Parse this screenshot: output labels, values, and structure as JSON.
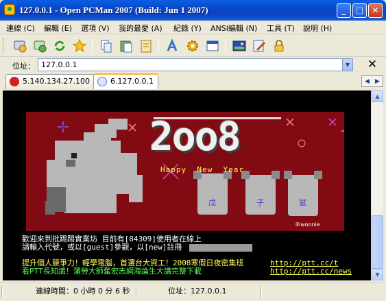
{
  "window": {
    "title": "127.0.0.1 - Open PCMan 2007 (Build: Jun  1 2007)",
    "minimize": "_",
    "maximize": "□",
    "close": "✕"
  },
  "menu": [
    "連線 (C)",
    "編輯 (E)",
    "選項 (V)",
    "我的最愛 (A)",
    "紀錄 (Y)",
    "ANSI編輯 (N)",
    "工具 (T)",
    "說明 (H)"
  ],
  "toolbar": {
    "icons": [
      "connect-icon",
      "reconnect-icon",
      "refresh-icon",
      "favorite-star-icon",
      "copy-icon",
      "paste-icon",
      "notes-icon",
      "font-icon",
      "settings-gear-icon",
      "window-icon",
      "fullscreen-icon",
      "edit-icon",
      "lock-icon"
    ]
  },
  "address": {
    "label": "位址：",
    "value": "127.0.0.1",
    "close": "✕"
  },
  "tabs": [
    {
      "label": "5.140.134.27.100",
      "icon": "disconnected-icon",
      "color": "#d42020",
      "active": false
    },
    {
      "label": "6.127.0.0.1",
      "icon": "connected-icon",
      "color": "#4f7fd6",
      "active": true
    }
  ],
  "terminal": {
    "art": {
      "title": "2oo8",
      "greeting": "Happy  New  Year",
      "rat_labels": [
        "戊",
        "子",
        "鼠"
      ],
      "signature": "®woonie"
    },
    "lines": [
      {
        "text": "歡迎來到批踢踢實業坊 目前有[84309]使用者在線上",
        "color": "#ffffff"
      },
      {
        "text": "請輸入代號，或以[guest]參觀，以[new]註冊",
        "color": "#ffffff"
      },
      {
        "text": "提升個人競爭力！輕學電腦，首選台大資工！2008寒假日夜密集班",
        "color": "#ffff55"
      },
      {
        "text": "看PTT長知識！蒲勞大師奮宏志網海論生大講完整下載",
        "color": "#55ff55"
      }
    ],
    "links": [
      "http://ptt.cc/t",
      "http://ptt.cc/news"
    ],
    "colors": {
      "background": "#000000",
      "art_bg": "#820a12",
      "link": "#ffff55"
    }
  },
  "status": {
    "connection_time": "連線時間：0 小時 0 分 6 秒",
    "address": "位址：127.0.0.1"
  }
}
